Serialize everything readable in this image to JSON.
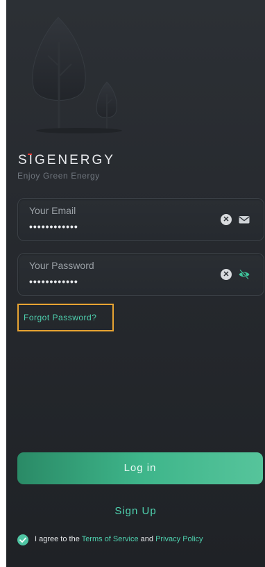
{
  "brand": {
    "logo_text": "SIGENERGY",
    "tagline": "Enjoy Green Energy"
  },
  "email": {
    "label": "Your Email",
    "value": "••••••••••••",
    "clear_icon": "clear-circle-icon",
    "trail_icon": "envelope-icon"
  },
  "password": {
    "label": "Your Password",
    "value": "••••••••••••",
    "clear_icon": "clear-circle-icon",
    "trail_icon": "eye-off-icon"
  },
  "forgot_password": "Forgot Password?",
  "login_label": "Log in",
  "signup_label": "Sign Up",
  "agree": {
    "prefix": "I agree to the",
    "terms": "Terms of Service",
    "and": "and",
    "privacy": "Privacy Policy",
    "checked": true
  },
  "colors": {
    "accent": "#4fd3b0",
    "background": "#26292e",
    "highlight": "#e8a432"
  }
}
